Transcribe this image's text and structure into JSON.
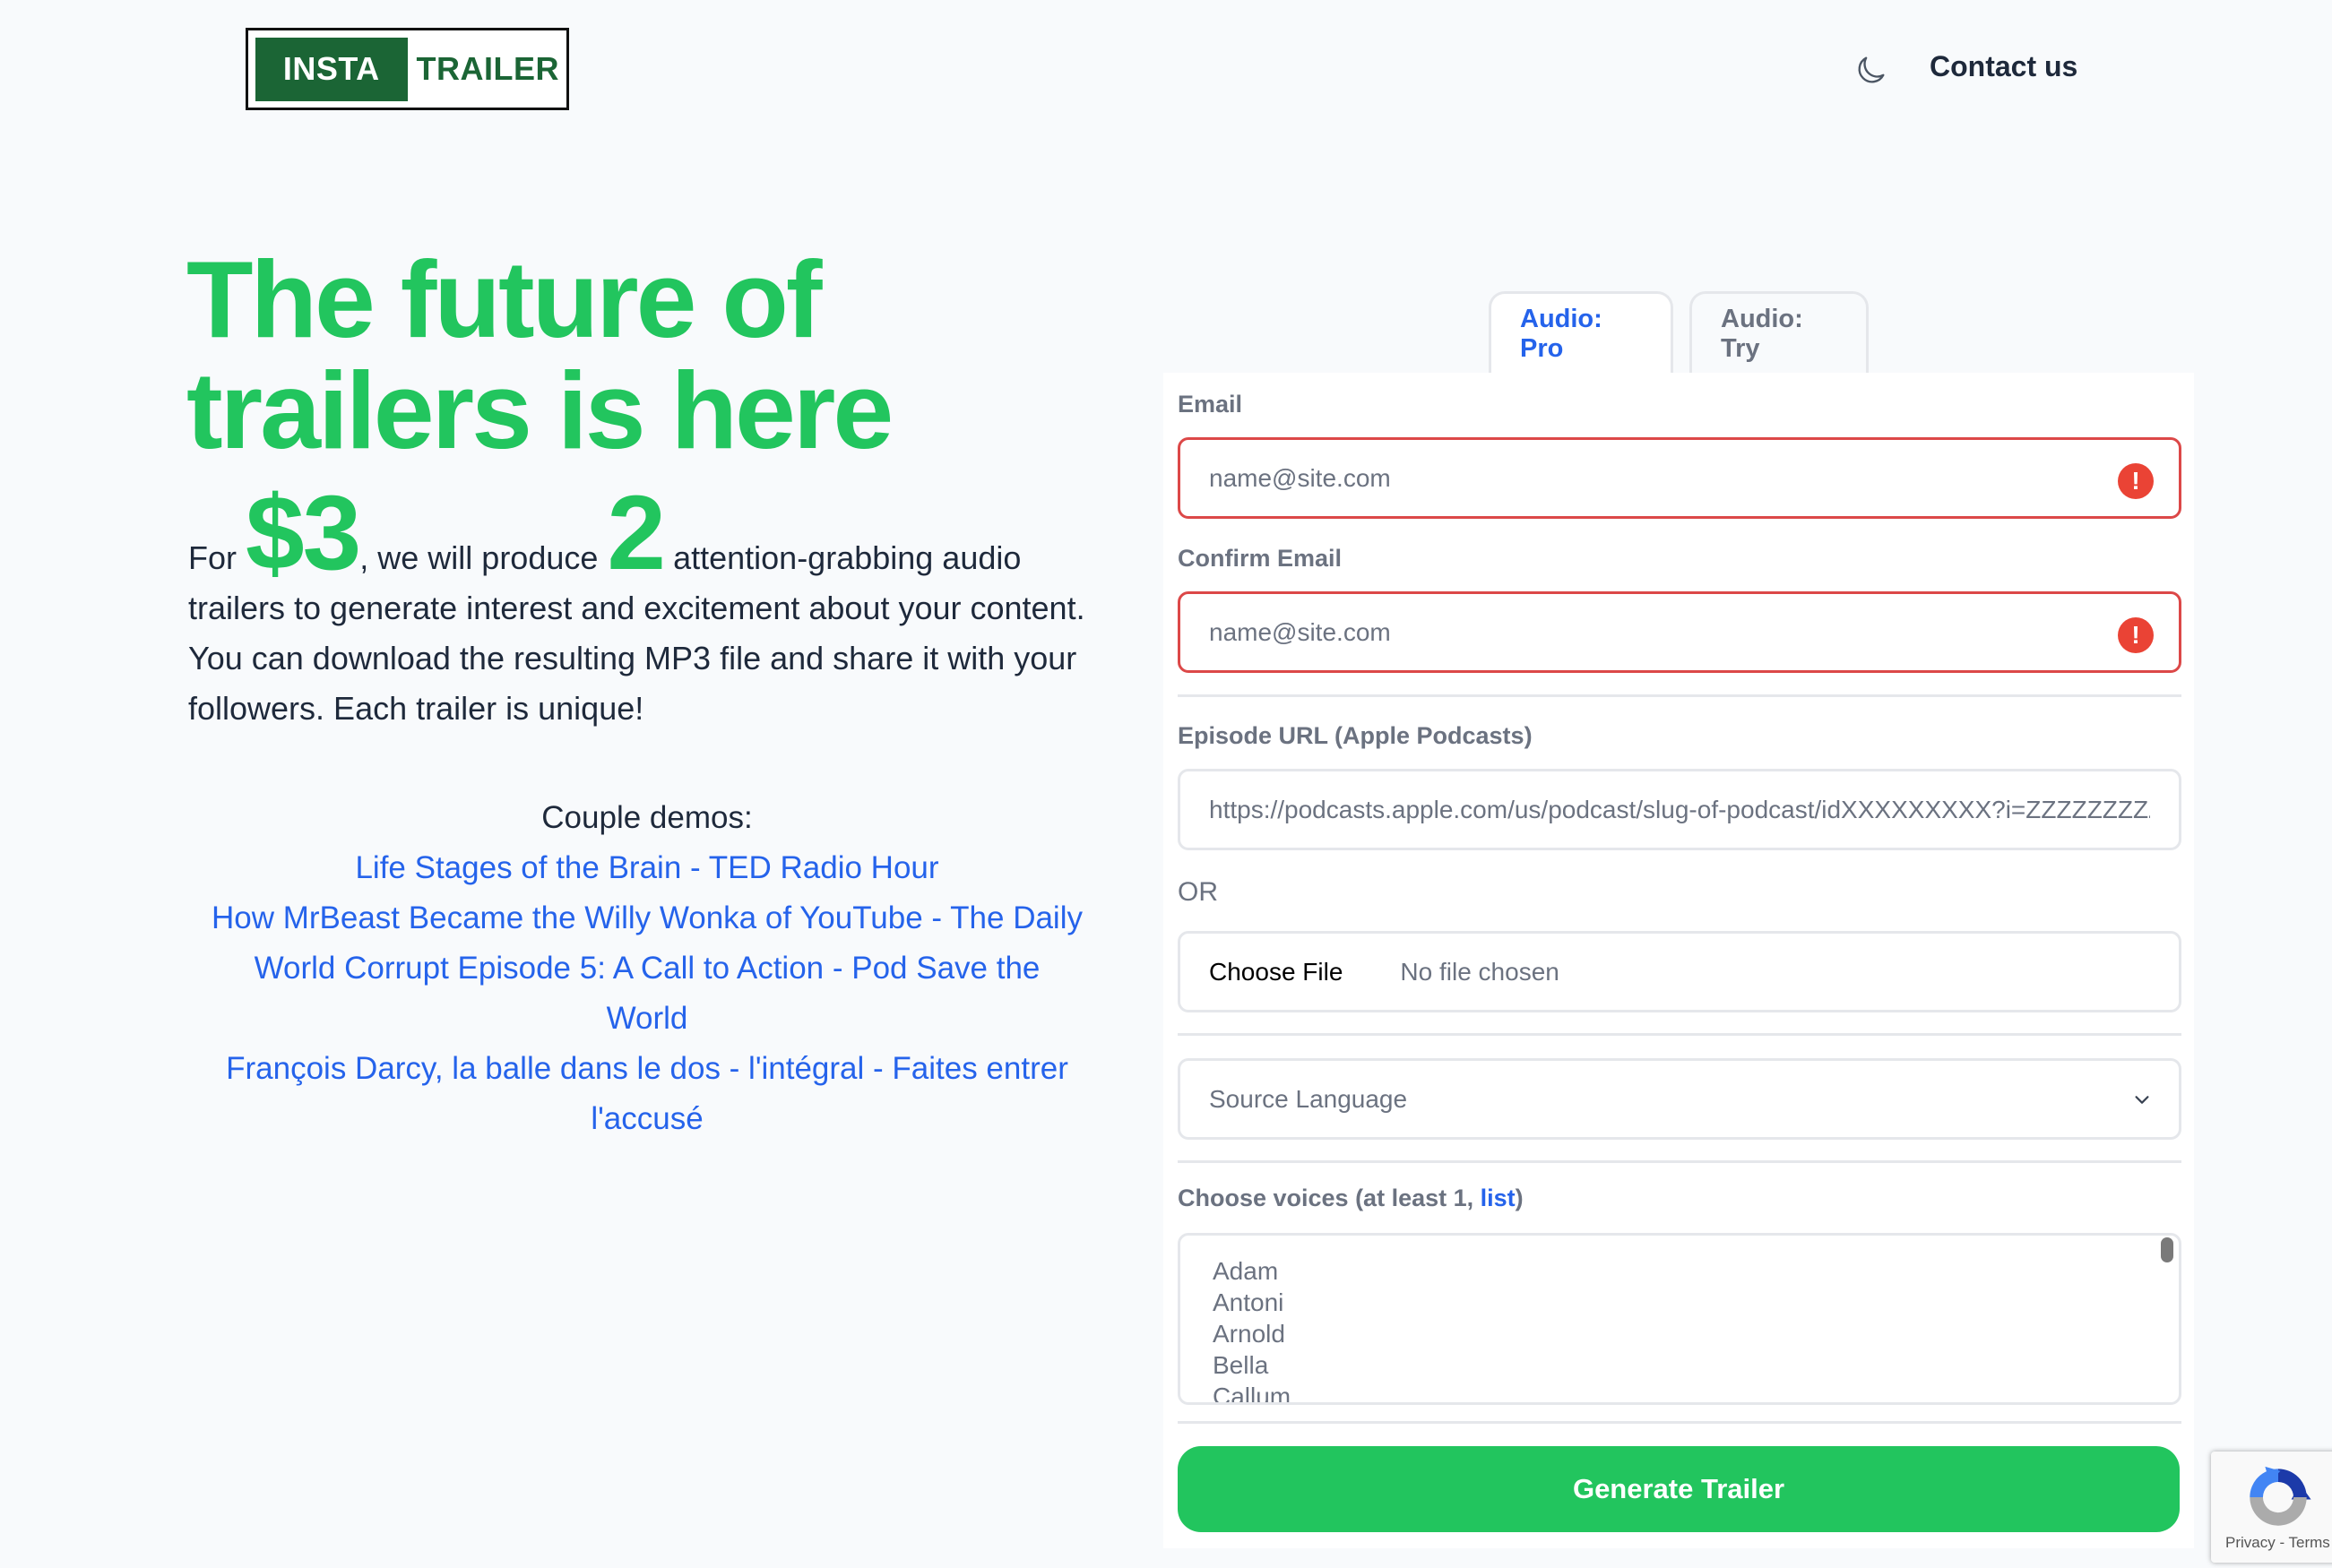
{
  "header": {
    "logo_part1": "INSTA",
    "logo_part2": "TRAILER",
    "theme_toggle_icon": "moon-icon",
    "contact_label": "Contact us"
  },
  "hero": {
    "title_line1": "The future of",
    "title_line2": "trailers is here",
    "text_for": "For",
    "price": "$3",
    "text_mid": ", we will produce",
    "count": "2",
    "text_rest": "attention-grabbing audio trailers to generate interest and excitement about your content. You can download the resulting MP3 file and share it with your followers. Each trailer is unique!"
  },
  "demos": {
    "title": "Couple demos:",
    "links": [
      "Life Stages of the Brain - TED Radio Hour",
      "How MrBeast Became the Willy Wonka of YouTube - The Daily",
      "World Corrupt Episode 5: A Call to Action - Pod Save the World",
      "François Darcy, la balle dans le dos - l'intégral - Faites entrer l'accusé"
    ]
  },
  "tabs": [
    {
      "label": "Audio: Pro",
      "active": true
    },
    {
      "label": "Audio: Try",
      "active": false
    }
  ],
  "form": {
    "email_label": "Email",
    "email_placeholder": "name@site.com",
    "confirm_email_label": "Confirm Email",
    "confirm_email_placeholder": "name@site.com",
    "episode_url_label": "Episode URL (Apple Podcasts)",
    "episode_url_placeholder": "https://podcasts.apple.com/us/podcast/slug-of-podcast/idXXXXXXXXX?i=ZZZZZZZZZZZZ",
    "or_label": "OR",
    "choose_file_label": "Choose File",
    "no_file_label": "No file chosen",
    "source_language_label": "Source Language",
    "voices_label_prefix": "Choose voices (at least 1, ",
    "voices_label_link": "list",
    "voices_label_suffix": ")",
    "voices": [
      "Adam",
      "Antoni",
      "Arnold",
      "Bella",
      "Callum"
    ],
    "generate_label": "Generate Trailer"
  },
  "recaptcha": {
    "links": "Privacy - Terms"
  },
  "colors": {
    "brand_green": "#22c55e",
    "logo_green": "#1b6535",
    "link_blue": "#2563eb",
    "error_red": "#dc4848"
  }
}
